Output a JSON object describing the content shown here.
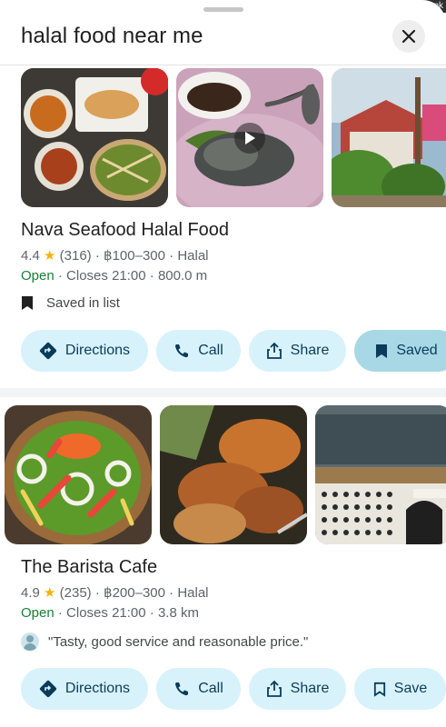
{
  "status": {
    "corner_text": "nk"
  },
  "search": {
    "query": "halal food near me",
    "close_icon": "close-icon"
  },
  "results": [
    {
      "name": "Nava Seafood Halal Food",
      "rating": "4.4",
      "reviews": "(316)",
      "price": "฿100–300",
      "category": "Halal",
      "status": "Open",
      "closes": "Closes 21:00",
      "distance": "800.0 m",
      "saved_text": "Saved in  list",
      "actions": {
        "directions": "Directions",
        "call": "Call",
        "share": "Share",
        "save": "Saved"
      }
    },
    {
      "name": "The Barista Cafe",
      "rating": "4.9",
      "reviews": "(235)",
      "price": "฿200–300",
      "category": "Halal",
      "status": "Open",
      "closes": "Closes 21:00",
      "distance": "3.8 km",
      "review_snippet": "\"Tasty, good service and reasonable price.\"",
      "actions": {
        "directions": "Directions",
        "call": "Call",
        "share": "Share",
        "save": "Save"
      }
    }
  ],
  "symbols": {
    "star": "★",
    "dot": "·"
  },
  "colors": {
    "open": "#188038",
    "star": "#f4b400",
    "button_bg": "#d7f2fa",
    "button_active_bg": "#a8d8e6",
    "button_text": "#0b3b5a"
  }
}
